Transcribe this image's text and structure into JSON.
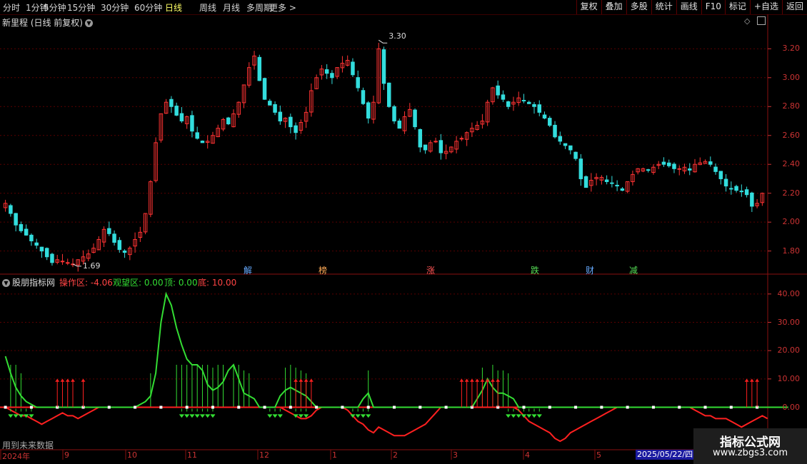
{
  "toolbar": {
    "periods": [
      "分时",
      "1分钟",
      "5分钟",
      "15分钟",
      "30分钟",
      "60分钟",
      "日线",
      "周线",
      "月线",
      "多周期",
      "更多 >"
    ],
    "active_period": "日线",
    "right_buttons": [
      "复权",
      "叠加",
      "多股",
      "统计",
      "画线",
      "F10",
      "标记",
      "+自选",
      "返回"
    ]
  },
  "main_chart": {
    "title": "新里程 (日线 前复权)",
    "y_ticks": [
      "3.20",
      "3.00",
      "2.80",
      "2.60",
      "2.40",
      "2.20",
      "2.00",
      "1.80"
    ],
    "high_label": "3.30",
    "low_label": "1.69",
    "events": [
      {
        "text": "解",
        "color": "#66aaff"
      },
      {
        "text": "榜",
        "color": "#ffaa55"
      },
      {
        "text": "涨",
        "color": "#ff5555"
      },
      {
        "text": "跌",
        "color": "#55dd55"
      },
      {
        "text": "财",
        "color": "#66aaff"
      },
      {
        "text": "减",
        "color": "#55dd55"
      }
    ]
  },
  "indicator": {
    "name": "股朋指标网",
    "op_zone": "操作区: -4.06",
    "watch_zone": "观望区: 0.00",
    "top": "顶: 0.00",
    "bottom": "底: 10.00",
    "y_ticks": [
      "40.00",
      "30.00",
      "20.00",
      "10.00",
      "0.00"
    ],
    "footer_note": "用到未来数据"
  },
  "x_axis": {
    "labels": [
      "2024年",
      "9",
      "10",
      "11",
      "12",
      "1",
      "2",
      "3",
      "4",
      "5"
    ],
    "cursor_date": "2025/05/22/四"
  },
  "watermark": {
    "line1": "指标公式网",
    "line2": "www.zbgs3.com"
  },
  "colors": {
    "up": "#ff3333",
    "down": "#33dddd",
    "indicator_line": "#33dd33",
    "zero_line": "#ff2020",
    "axis": "#cc3333"
  },
  "chart_data": {
    "type": "candlestick",
    "y_axis_range": [
      1.69,
      3.3
    ],
    "close_series": [
      2.13,
      2.06,
      1.98,
      1.94,
      1.91,
      1.87,
      1.84,
      1.8,
      1.76,
      1.72,
      1.74,
      1.73,
      1.72,
      1.71,
      1.74,
      1.76,
      1.78,
      1.82,
      1.88,
      1.95,
      1.92,
      1.86,
      1.81,
      1.79,
      1.82,
      1.88,
      1.93,
      2.06,
      2.28,
      2.55,
      2.75,
      2.83,
      2.8,
      2.74,
      2.7,
      2.73,
      2.63,
      2.58,
      2.55,
      2.56,
      2.6,
      2.65,
      2.71,
      2.68,
      2.75,
      2.83,
      2.95,
      3.07,
      3.15,
      2.98,
      2.85,
      2.81,
      2.76,
      2.7,
      2.72,
      2.66,
      2.62,
      2.69,
      2.76,
      2.91,
      3.0,
      3.06,
      3.03,
      3.0,
      3.07,
      3.1,
      3.12,
      3.02,
      2.93,
      2.82,
      2.72,
      2.83,
      3.2,
      2.96,
      2.8,
      2.7,
      2.65,
      2.73,
      2.78,
      2.66,
      2.52,
      2.5,
      2.55,
      2.56,
      2.48,
      2.49,
      2.52,
      2.56,
      2.58,
      2.62,
      2.65,
      2.67,
      2.7,
      2.83,
      2.93,
      2.88,
      2.85,
      2.8,
      2.83,
      2.86,
      2.84,
      2.82,
      2.8,
      2.76,
      2.72,
      2.67,
      2.59,
      2.56,
      2.53,
      2.5,
      2.44,
      2.3,
      2.24,
      2.29,
      2.31,
      2.31,
      2.28,
      2.27,
      2.25,
      2.22,
      2.28,
      2.33,
      2.37,
      2.37,
      2.36,
      2.38,
      2.4,
      2.4,
      2.39,
      2.37,
      2.37,
      2.38,
      2.36,
      2.4,
      2.41,
      2.42,
      2.4,
      2.35,
      2.3,
      2.25,
      2.23,
      2.22,
      2.21,
      2.19,
      2.11,
      2.13,
      2.2
    ],
    "indicator_series": [
      18,
      12,
      7,
      4,
      2,
      1,
      0,
      0,
      0,
      0,
      0,
      0,
      0,
      0,
      0,
      0,
      0,
      0,
      0,
      0,
      0,
      0,
      0,
      0,
      0,
      0,
      1,
      2,
      4,
      12,
      30,
      40,
      36,
      28,
      22,
      17,
      15,
      15,
      13,
      8,
      6,
      7,
      9,
      13,
      15,
      10,
      5,
      4,
      3,
      0,
      0,
      0,
      0,
      4,
      6,
      7,
      6,
      5,
      4,
      2,
      0,
      0,
      0,
      0,
      0,
      0,
      0,
      0,
      0,
      3,
      5,
      0,
      0,
      0,
      0,
      0,
      0,
      0,
      0,
      0,
      0,
      0,
      0,
      0,
      0,
      0,
      0,
      0,
      0,
      0,
      0,
      3,
      6,
      10,
      7,
      5,
      5,
      4,
      3,
      0,
      0,
      0,
      0,
      0,
      0,
      0,
      0,
      0,
      0,
      0,
      0,
      0,
      0,
      0,
      0,
      0,
      0,
      0,
      0,
      0,
      0,
      0,
      0,
      0,
      0,
      0,
      0,
      0,
      0,
      0,
      0,
      0,
      0,
      0,
      0,
      0,
      0,
      0,
      0,
      0,
      0,
      0,
      0,
      0,
      0,
      0,
      0,
      0,
      0,
      0,
      0,
      0
    ],
    "op_series": [
      0,
      -1,
      -2,
      -3,
      -3,
      -4,
      -5,
      -6,
      -5,
      -4,
      -3,
      -2,
      -3,
      -3,
      -4,
      -3,
      -2,
      -1,
      0,
      0,
      0,
      0,
      0,
      0,
      0,
      0,
      0,
      0,
      0,
      0,
      0,
      0,
      0,
      0,
      0,
      0,
      0,
      0,
      0,
      0,
      0,
      0,
      0,
      0,
      0,
      0,
      0,
      0,
      0,
      0,
      0,
      0,
      0,
      0,
      -1,
      -2,
      -3,
      -4,
      -4,
      -3,
      -1,
      0,
      0,
      0,
      0,
      0,
      -1,
      -3,
      -5,
      -6,
      -8,
      -9,
      -7,
      -8,
      -9,
      -10,
      -10,
      -10,
      -9,
      -8,
      -7,
      -6,
      -4,
      -2,
      0,
      0,
      0,
      0,
      0,
      0,
      0,
      0,
      0,
      0,
      0,
      0,
      0,
      0,
      0,
      -1,
      -3,
      -5,
      -6,
      -7,
      -8,
      -9,
      -11,
      -12,
      -11,
      -9,
      -8,
      -7,
      -6,
      -5,
      -4,
      -3,
      -2,
      -1,
      0,
      0,
      0,
      0,
      0,
      0,
      0,
      0,
      0,
      0,
      0,
      0,
      0,
      0,
      0,
      -1,
      -2,
      -3,
      -3,
      -4,
      -4,
      -4,
      -5,
      -6,
      -7,
      -6,
      -5,
      -4,
      -3,
      -4
    ]
  }
}
